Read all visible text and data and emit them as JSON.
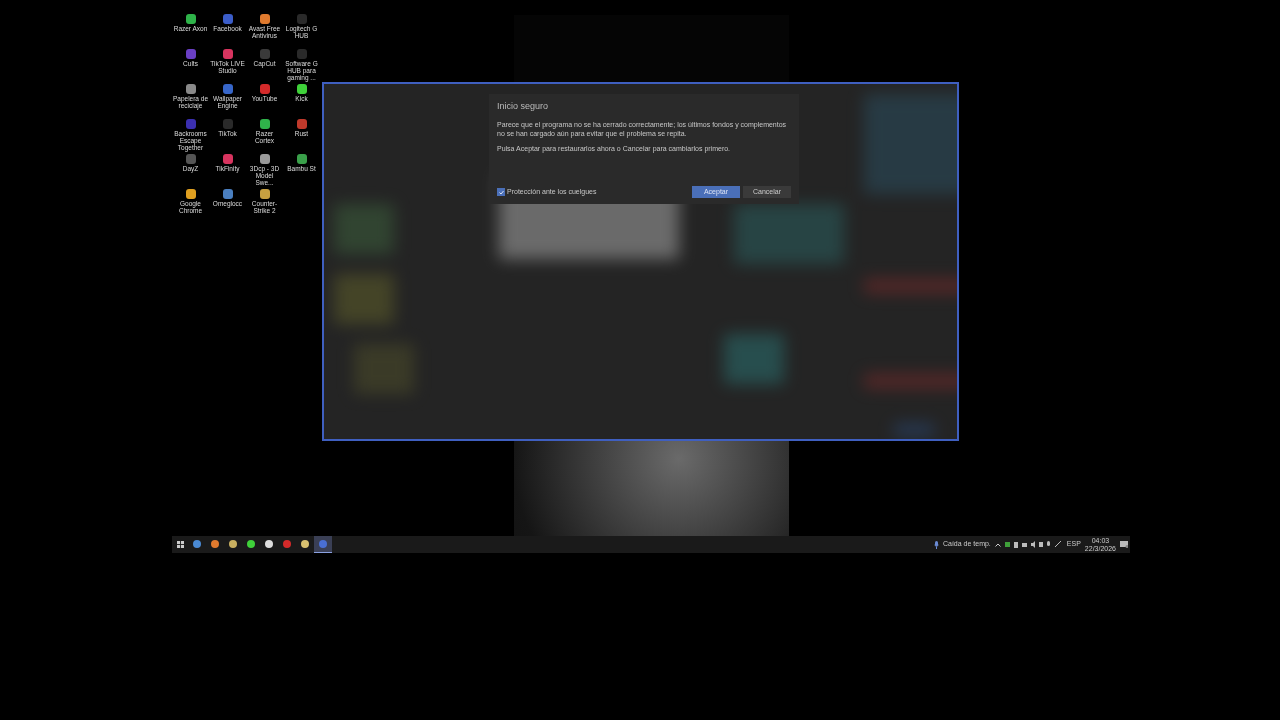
{
  "desktop_icons": [
    {
      "label": "Razer Axon",
      "color": "#2fb34a"
    },
    {
      "label": "Facebook",
      "color": "#3b5dc9"
    },
    {
      "label": "Avast Free Antivirus",
      "color": "#e07a2e"
    },
    {
      "label": "Logitech G HUB",
      "color": "#2a2a2a"
    },
    {
      "label": "Cults",
      "color": "#6a3fc4"
    },
    {
      "label": "TikTok LIVE Studio",
      "color": "#d8345f"
    },
    {
      "label": "CapCut",
      "color": "#3a3a3a"
    },
    {
      "label": "Software G HUB para gaming ...",
      "color": "#2a2a2a"
    },
    {
      "label": "Papelera de reciclaje",
      "color": "#8a8a8a"
    },
    {
      "label": "Wallpaper Engine",
      "color": "#3766c9"
    },
    {
      "label": "YouTube",
      "color": "#d42a2a"
    },
    {
      "label": "Kick",
      "color": "#3fd13a"
    },
    {
      "label": "Backrooms Escape Together",
      "color": "#3b2fb0"
    },
    {
      "label": "TikTok",
      "color": "#2a2a2a"
    },
    {
      "label": "Razer Cortex",
      "color": "#2fb34a"
    },
    {
      "label": "Rust",
      "color": "#c0392b"
    },
    {
      "label": "DayZ",
      "color": "#555555"
    },
    {
      "label": "TikFinity",
      "color": "#d8345f"
    },
    {
      "label": "3Dcp - 3D Model Swe...",
      "color": "#9a9a9a"
    },
    {
      "label": "Bambu St",
      "color": "#3aa04a"
    },
    {
      "label": "Google Chrome",
      "color": "#e0a020"
    },
    {
      "label": "Omeglocc",
      "color": "#4a7fc0"
    },
    {
      "label": "Counter-Strike 2",
      "color": "#c7a040"
    }
  ],
  "dialog": {
    "title": "Inicio seguro",
    "paragraphs": [
      "Parece que el programa no se ha cerrado correctamente; los últimos fondos y complementos no se han cargado aún para evitar que el problema se repita.",
      "Pulsa Aceptar para restaurarlos ahora o Cancelar para cambiarlos primero."
    ],
    "checkbox": {
      "label": "Protección ante los cuelgues",
      "checked": true
    },
    "buttons": [
      {
        "label": "Aceptar",
        "kind": "primary"
      },
      {
        "label": "Cancelar",
        "kind": "secondary"
      }
    ]
  },
  "taskbar": {
    "apps": [
      {
        "color": "#4a8ad4",
        "selected": false
      },
      {
        "color": "#e07a2e",
        "selected": false
      },
      {
        "color": "#c9b060",
        "selected": false
      },
      {
        "color": "#3fd13a",
        "selected": false
      },
      {
        "color": "#dddddd",
        "selected": false
      },
      {
        "color": "#d42a2a",
        "selected": false
      },
      {
        "color": "#d8c070",
        "selected": false
      },
      {
        "color": "#4a6fd4",
        "selected": true
      }
    ],
    "weather": "Caída de temp.",
    "language": "ESP",
    "time": "04:03",
    "date": "22/3/2026"
  }
}
